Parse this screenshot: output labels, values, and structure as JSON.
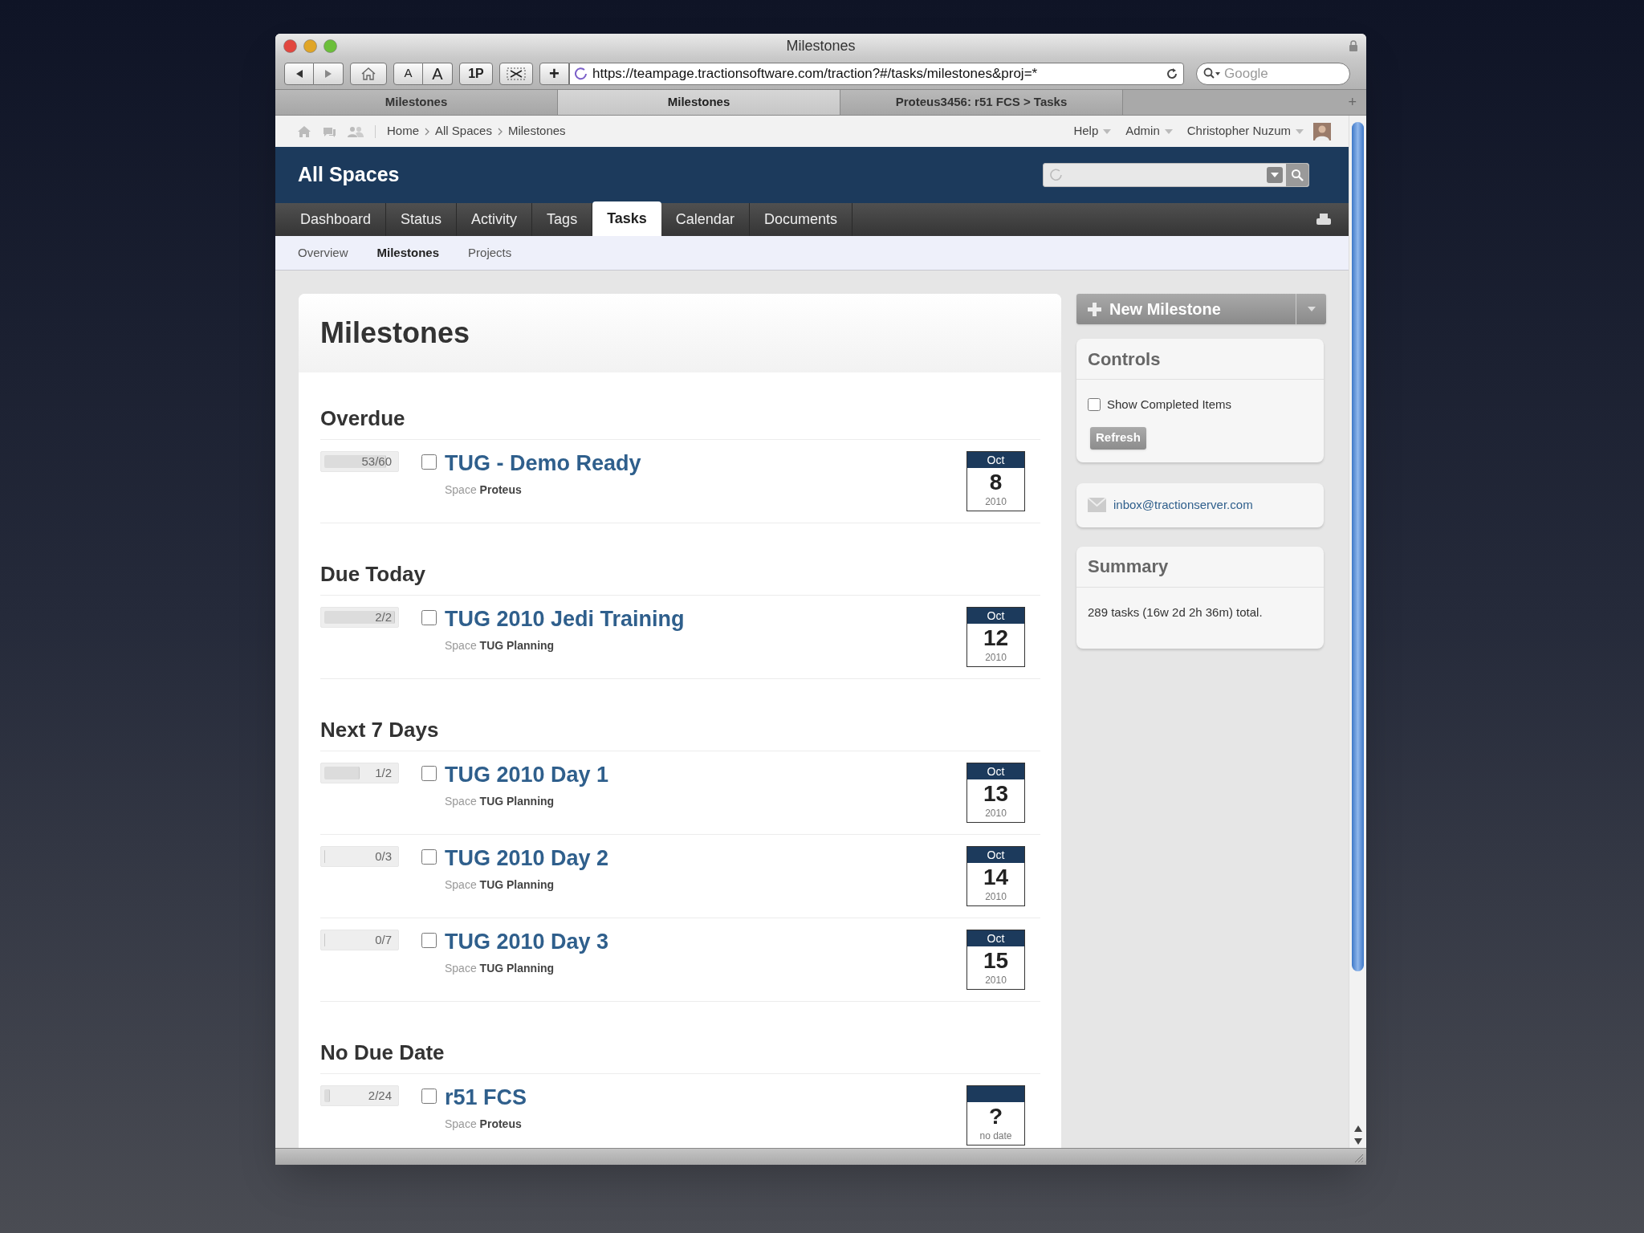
{
  "browser": {
    "title": "Milestones",
    "url": "https://teampage.tractionsoftware.com/traction?#/tasks/milestones&proj=*",
    "search_placeholder": "Google",
    "text_buttons": [
      "A",
      "A",
      "1P"
    ],
    "add_button": "+"
  },
  "browser_tabs": [
    {
      "label": "Milestones",
      "selected": false
    },
    {
      "label": "Milestones",
      "selected": true
    },
    {
      "label": "Proteus3456: r51 FCS > Tasks",
      "selected": false
    }
  ],
  "new_tab": "+",
  "breadcrumb": [
    "Home",
    "All Spaces",
    "Milestones"
  ],
  "user_menu": [
    "Help",
    "Admin",
    "Christopher Nuzum"
  ],
  "header": {
    "title": "All Spaces"
  },
  "nav_tabs": [
    {
      "label": "Dashboard",
      "selected": false
    },
    {
      "label": "Status",
      "selected": false
    },
    {
      "label": "Activity",
      "selected": false
    },
    {
      "label": "Tags",
      "selected": false
    },
    {
      "label": "Tasks",
      "selected": true
    },
    {
      "label": "Calendar",
      "selected": false
    },
    {
      "label": "Documents",
      "selected": false
    }
  ],
  "sub_tabs": [
    {
      "label": "Overview",
      "selected": false
    },
    {
      "label": "Milestones",
      "selected": true
    },
    {
      "label": "Projects",
      "selected": false
    }
  ],
  "main": {
    "title": "Milestones",
    "sections": [
      {
        "heading": "Overdue",
        "items": [
          {
            "progress": "53/60",
            "level": 0.88,
            "checked": false,
            "title": "TUG - Demo Ready",
            "space_label": "Space",
            "space": "Proteus",
            "month": "Oct",
            "day": "8",
            "year": "2010"
          }
        ]
      },
      {
        "heading": "Due Today",
        "items": [
          {
            "progress": "2/2",
            "level": 1,
            "checked": false,
            "title": "TUG 2010 Jedi Training",
            "space_label": "Space",
            "space": "TUG Planning",
            "month": "Oct",
            "day": "12",
            "year": "2010"
          }
        ]
      },
      {
        "heading": "Next 7 Days",
        "items": [
          {
            "progress": "1/2",
            "level": 0.5,
            "checked": false,
            "title": "TUG 2010 Day 1",
            "space_label": "Space",
            "space": "TUG Planning",
            "month": "Oct",
            "day": "13",
            "year": "2010"
          },
          {
            "progress": "0/3",
            "level": 0,
            "checked": false,
            "title": "TUG 2010 Day 2",
            "space_label": "Space",
            "space": "TUG Planning",
            "month": "Oct",
            "day": "14",
            "year": "2010"
          },
          {
            "progress": "0/7",
            "level": 0,
            "checked": false,
            "title": "TUG 2010 Day 3",
            "space_label": "Space",
            "space": "TUG Planning",
            "month": "Oct",
            "day": "15",
            "year": "2010"
          }
        ]
      },
      {
        "heading": "No Due Date",
        "items": [
          {
            "progress": "2/24",
            "level": 0.08,
            "checked": false,
            "title": "r51 FCS",
            "space_label": "Space",
            "space": "Proteus",
            "day": "?",
            "year": "no date"
          }
        ]
      }
    ]
  },
  "sidebar": {
    "new_button": "New Milestone",
    "controls": {
      "title": "Controls",
      "checkbox": {
        "label": "Show Completed Items",
        "checked": false
      },
      "button": "Refresh"
    },
    "email": "inbox@tractionserver.com",
    "summary": {
      "title": "Summary",
      "text": "289 tasks (16w 2d 2h 36m) total."
    }
  }
}
